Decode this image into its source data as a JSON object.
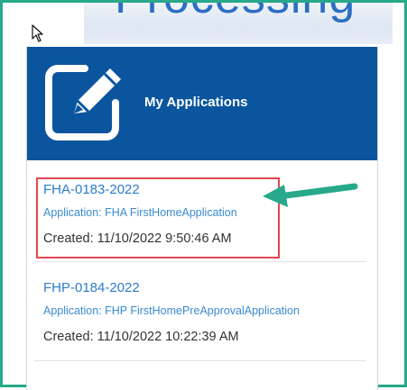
{
  "banner": {
    "text": "Processing"
  },
  "panel": {
    "title": "My Applications"
  },
  "applications": [
    {
      "id": "FHA-0183-2022",
      "type": "Application: FHA FirstHomeApplication",
      "created": "Created: 11/10/2022 9:50:46 AM"
    },
    {
      "id": "FHP-0184-2022",
      "type": "Application: FHP FirstHomePreApprovalApplication",
      "created": "Created: 11/10/2022 10:22:39 AM"
    }
  ],
  "colors": {
    "header": "#0b559e",
    "link": "#2c7cc9",
    "highlight": "#e2474f",
    "arrow": "#27a98a",
    "frame": "#27a98a"
  },
  "icons": {
    "header": "edit-pencil-icon",
    "cursor": "mouse-pointer-icon",
    "annotation": "arrow-annotation"
  }
}
